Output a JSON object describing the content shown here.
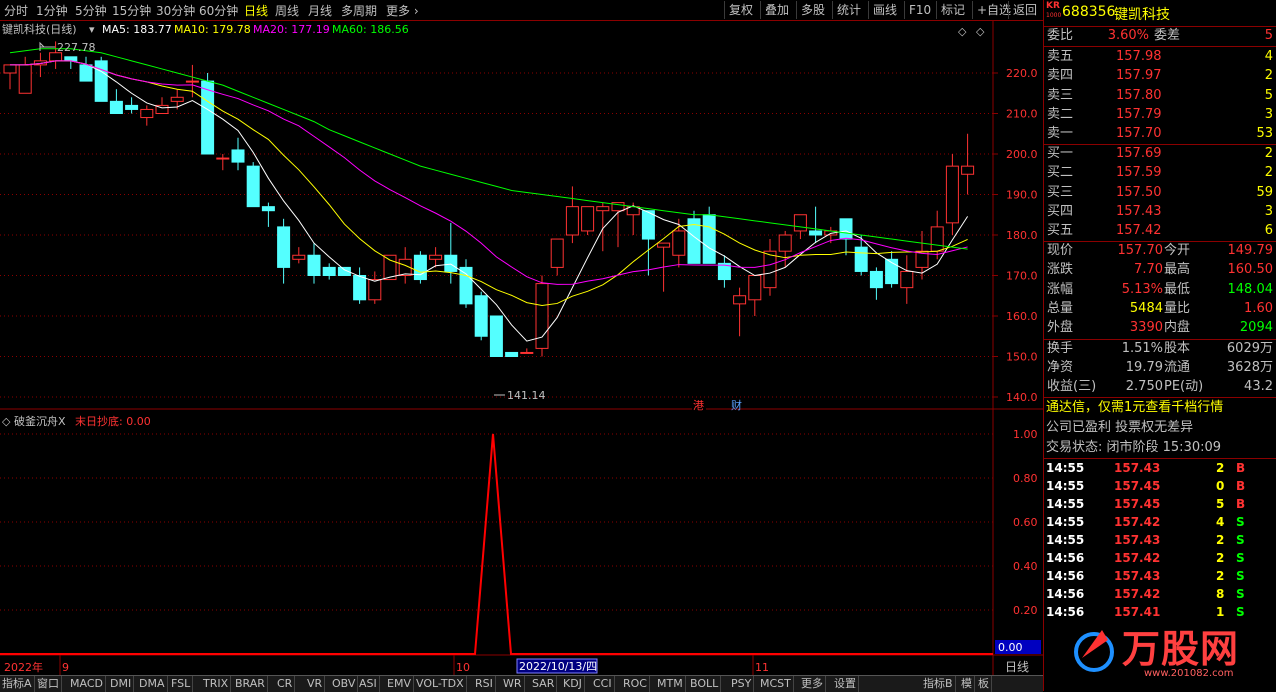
{
  "toolbar": {
    "periods": [
      "分时",
      "1分钟",
      "5分钟",
      "15分钟",
      "30分钟",
      "60分钟",
      "日线",
      "周线",
      "月线",
      "多周期",
      "更多"
    ],
    "active_period": "日线",
    "tools": [
      "复权",
      "叠加",
      "多股",
      "统计",
      "画线",
      "F10",
      "标记",
      "+自选",
      "返回"
    ]
  },
  "main_chart": {
    "stock_label": "键凯科技(日线)",
    "ma5": "MA5: 183.77",
    "ma10": "MA10: 179.78",
    "ma20": "MA20: 177.19",
    "ma60": "MA60: 186.56",
    "high_mark": "227.78",
    "low_mark": "141.14",
    "tag_hk": "港",
    "tag_fin": "财",
    "colors": {
      "ma5": "#ffffff",
      "ma10": "#ffff00",
      "ma20": "#ff00ff",
      "ma60": "#00ff00",
      "up": "#ff3232",
      "down": "#54ffff",
      "grid": "#8b0000"
    },
    "y_ticks": [
      "220.0",
      "210.0",
      "200.0",
      "190.0",
      "180.0",
      "170.0",
      "160.0",
      "150.0",
      "140.0"
    ]
  },
  "indicator": {
    "name": "破釜沉舟X",
    "series_label": "末日抄底: 0.00",
    "y_ticks": [
      "1.00",
      "0.80",
      "0.60",
      "0.40",
      "0.20"
    ],
    "current": "0.00"
  },
  "date_axis": {
    "year": "2022年",
    "m9": "9",
    "m10": "10",
    "cursor_date": "2022/10/13/四",
    "m11": "11",
    "period_label": "日线"
  },
  "bottom_tabs": [
    "指标A",
    "窗口",
    "MACD",
    "DMI",
    "DMA",
    "FSL",
    "TRIX",
    "BRAR",
    "CR",
    "VR",
    "OBV",
    "ASI",
    "EMV",
    "VOL-TDX",
    "RSI",
    "WR",
    "SAR",
    "KDJ",
    "CCI",
    "ROC",
    "MTM",
    "BOLL",
    "PSY",
    "MCST",
    "更多",
    "设置"
  ],
  "bottom_right_tabs": [
    "指标B",
    "模",
    "板"
  ],
  "quote": {
    "logo": "KR",
    "logo_sub": "1000",
    "code": "688356",
    "name": "键凯科技",
    "weibi_label": "委比",
    "weibi": "3.60%",
    "weicha_label": "委差",
    "weicha": "5",
    "asks": [
      {
        "label": "卖五",
        "price": "157.98",
        "vol": "4"
      },
      {
        "label": "卖四",
        "price": "157.97",
        "vol": "2"
      },
      {
        "label": "卖三",
        "price": "157.80",
        "vol": "5"
      },
      {
        "label": "卖二",
        "price": "157.79",
        "vol": "3"
      },
      {
        "label": "卖一",
        "price": "157.70",
        "vol": "53"
      }
    ],
    "bids": [
      {
        "label": "买一",
        "price": "157.69",
        "vol": "2"
      },
      {
        "label": "买二",
        "price": "157.59",
        "vol": "2"
      },
      {
        "label": "买三",
        "price": "157.50",
        "vol": "59"
      },
      {
        "label": "买四",
        "price": "157.43",
        "vol": "3"
      },
      {
        "label": "买五",
        "price": "157.42",
        "vol": "6"
      }
    ],
    "stats": [
      {
        "l1": "现价",
        "v1": "157.70",
        "l2": "今开",
        "v2": "149.79"
      },
      {
        "l1": "涨跌",
        "v1": "7.70",
        "l2": "最高",
        "v2": "160.50"
      },
      {
        "l1": "涨幅",
        "v1": "5.13%",
        "l2": "最低",
        "v2": "148.04"
      },
      {
        "l1": "总量",
        "v1": "5484",
        "l2": "量比",
        "v2": "1.60"
      },
      {
        "l1": "外盘",
        "v1": "3390",
        "l2": "内盘",
        "v2": "2094"
      }
    ],
    "stats2": [
      {
        "l1": "换手",
        "v1": "1.51%",
        "l2": "股本",
        "v2": "6029万"
      },
      {
        "l1": "净资",
        "v1": "19.79",
        "l2": "流通",
        "v2": "3628万"
      },
      {
        "l1": "收益(三)",
        "v1": "2.750",
        "l2": "PE(动)",
        "v2": "43.2"
      }
    ],
    "promo": "通达信，仅需1元查看千档行情",
    "notice": "公司已盈利 投票权无差异",
    "trade_status": "交易状态: 闭市阶段 15:30:09",
    "ticks": [
      {
        "t": "14:55",
        "p": "157.43",
        "v": "2",
        "bs": "B"
      },
      {
        "t": "14:55",
        "p": "157.45",
        "v": "0",
        "bs": "B"
      },
      {
        "t": "14:55",
        "p": "157.45",
        "v": "5",
        "bs": "B"
      },
      {
        "t": "14:55",
        "p": "157.42",
        "v": "4",
        "bs": "S"
      },
      {
        "t": "14:55",
        "p": "157.43",
        "v": "2",
        "bs": "S"
      },
      {
        "t": "14:56",
        "p": "157.42",
        "v": "2",
        "bs": "S"
      },
      {
        "t": "14:56",
        "p": "157.43",
        "v": "2",
        "bs": "S"
      },
      {
        "t": "14:56",
        "p": "157.42",
        "v": "8",
        "bs": "S"
      },
      {
        "t": "14:56",
        "p": "157.41",
        "v": "1",
        "bs": "S"
      }
    ],
    "watermark": "万股网",
    "watermark_sub": "www.201082.com"
  }
}
